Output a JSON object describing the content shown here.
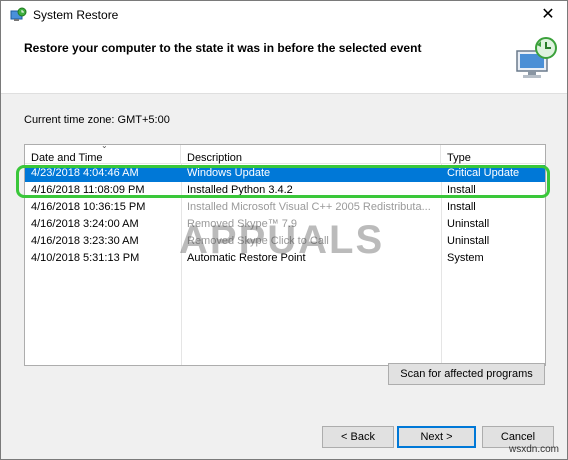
{
  "window": {
    "title": "System Restore",
    "close_glyph": "✕"
  },
  "header": {
    "title": "Restore your computer to the state it was in before the selected event",
    "art_icon": "system-restore-art-icon"
  },
  "content": {
    "timezone": "Current time zone: GMT+5:00",
    "columns": [
      "Date and Time",
      "Description",
      "Type"
    ],
    "rows": [
      {
        "date": "4/23/2018 4:04:46 AM",
        "description": "Windows Update",
        "type": "Critical Update",
        "selected": true
      },
      {
        "date": "4/16/2018 11:08:09 PM",
        "description": "Installed Python 3.4.2",
        "type": "Install",
        "selected": false
      },
      {
        "date": "4/16/2018 10:36:15 PM",
        "description": "Installed Microsoft Visual C++ 2005 Redistributa...",
        "type": "Install",
        "selected": false
      },
      {
        "date": "4/16/2018 3:24:00 AM",
        "description": "Removed Skype™ 7.9",
        "type": "Uninstall",
        "selected": false
      },
      {
        "date": "4/16/2018 3:23:30 AM",
        "description": "Removed Skype Click to Call",
        "type": "Uninstall",
        "selected": false
      },
      {
        "date": "4/10/2018 5:31:13 PM",
        "description": "Automatic Restore Point",
        "type": "System",
        "selected": false
      }
    ],
    "scan_button": "Scan for affected programs"
  },
  "footer": {
    "back_label": "< Back",
    "next_label": "Next >",
    "cancel_label": "Cancel"
  },
  "watermarks": {
    "brand": "APPUALS",
    "site": "wsxdn.com"
  },
  "colors": {
    "selection": "#0078d7",
    "highlight_ring": "#3ac73a"
  }
}
